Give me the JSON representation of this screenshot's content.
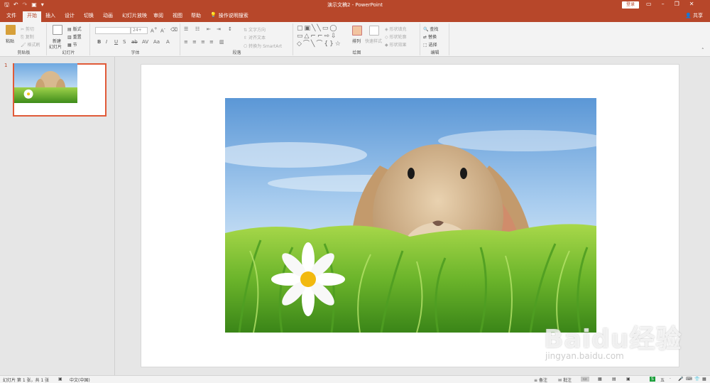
{
  "app": {
    "doc_title": "演示文稿2  -  PowerPoint",
    "login_label": "登录",
    "share_label": "共享",
    "tell_me": "操作说明搜索"
  },
  "tabs": [
    {
      "label": "文件"
    },
    {
      "label": "开始",
      "active": true
    },
    {
      "label": "插入"
    },
    {
      "label": "设计"
    },
    {
      "label": "切换"
    },
    {
      "label": "动画"
    },
    {
      "label": "幻灯片放映"
    },
    {
      "label": "审阅"
    },
    {
      "label": "视图"
    },
    {
      "label": "帮助"
    }
  ],
  "ribbon": {
    "clipboard": {
      "paste": "粘贴",
      "cut": "剪切",
      "copy": "复制",
      "format_painter": "格式刷",
      "label": "剪贴板"
    },
    "slides": {
      "new_slide": "新建",
      "new_slide_2": "幻灯片",
      "layout": "版式",
      "reset": "重置",
      "section": "节",
      "label": "幻灯片"
    },
    "font": {
      "font_size": "24+",
      "label": "字体"
    },
    "paragraph": {
      "text_direction": "文字方向",
      "align_text": "对齐文本",
      "smartart": "转换为 SmartArt",
      "label": "段落"
    },
    "drawing": {
      "arrange": "排列",
      "quick_styles": "快速样式",
      "shape_fill": "形状填充",
      "shape_outline": "形状轮廓",
      "shape_effects": "形状效果",
      "label": "绘图"
    },
    "editing": {
      "find": "查找",
      "replace": "替换",
      "select": "选择",
      "label": "编辑"
    }
  },
  "thumbnails": [
    {
      "number": "1"
    }
  ],
  "status": {
    "slide_info": "幻灯片 第 1 张，共 1 张",
    "language": "中文(中国)",
    "notes": "备注",
    "comments": "批注"
  },
  "watermark": {
    "text": "Baidu经验",
    "url": "jingyan.baidu.com"
  },
  "colors": {
    "accent": "#b7472a",
    "selection": "#e05a38"
  }
}
